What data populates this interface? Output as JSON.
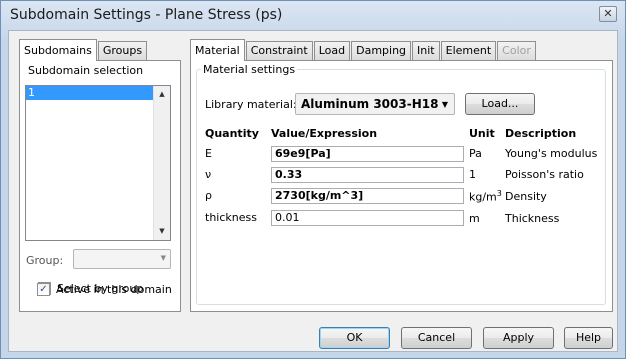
{
  "window": {
    "title": "Subdomain Settings - Plane Stress (ps)"
  },
  "left_tabs": [
    "Subdomains",
    "Groups"
  ],
  "subdomain_selection": {
    "title": "Subdomain selection",
    "items": [
      "1"
    ],
    "group_label": "Group:",
    "group_value": "",
    "select_by_group": "Select by group",
    "select_by_group_checked": false,
    "active_in_domain": "Active in this domain",
    "active_in_domain_checked": true
  },
  "right_tabs": [
    "Material",
    "Constraint",
    "Load",
    "Damping",
    "Init",
    "Element",
    "Color"
  ],
  "material": {
    "group_title": "Material settings",
    "library_label": "Library material:",
    "library_value": "Aluminum 3003-H18",
    "load_button": "Load...",
    "headers": {
      "quantity": "Quantity",
      "value": "Value/Expression",
      "unit": "Unit",
      "description": "Description"
    },
    "rows": [
      {
        "quantity": "E",
        "value": "69e9[Pa]",
        "unit": "Pa",
        "unit_sup": "",
        "description": "Young's modulus",
        "bold": true
      },
      {
        "quantity": "ν",
        "value": "0.33",
        "unit": "1",
        "unit_sup": "",
        "description": "Poisson's ratio",
        "bold": true
      },
      {
        "quantity": "ρ",
        "value": "2730[kg/m^3]",
        "unit": "kg/m",
        "unit_sup": "3",
        "description": "Density",
        "bold": true
      },
      {
        "quantity": "thickness",
        "value": "0.01",
        "unit": "m",
        "unit_sup": "",
        "description": "Thickness",
        "bold": false
      }
    ]
  },
  "buttons": {
    "ok": "OK",
    "cancel": "Cancel",
    "apply": "Apply",
    "help": "Help"
  },
  "icons": {
    "close": "close-icon",
    "dropdown": "chevron-down-icon"
  },
  "colors": {
    "selection": "#3399ff",
    "title_bar": "#c6d6ea"
  }
}
